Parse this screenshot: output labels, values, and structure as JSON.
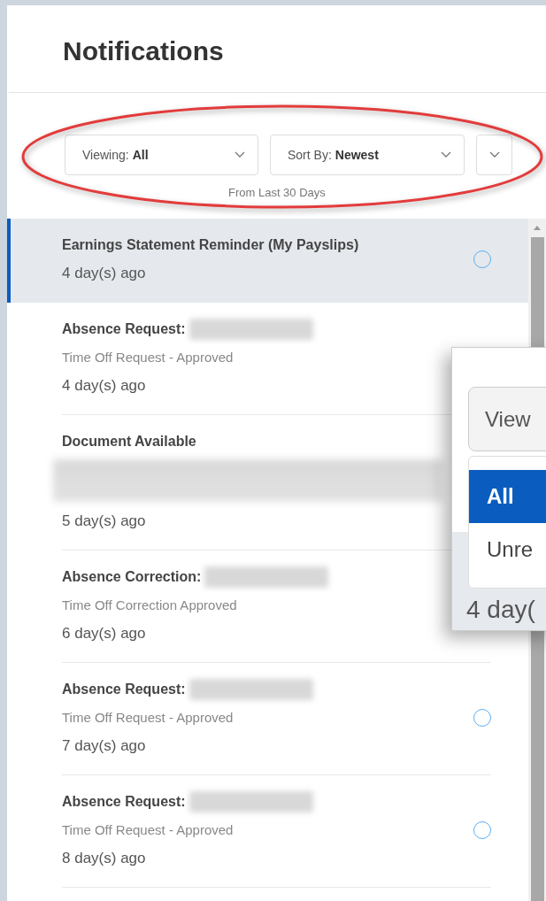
{
  "header": {
    "title": "Notifications"
  },
  "filters": {
    "viewing": {
      "label": "Viewing:",
      "value": "All"
    },
    "sort": {
      "label": "Sort By:",
      "value": "Newest"
    },
    "range": "From Last 30 Days"
  },
  "notifications": [
    {
      "kind": "plain",
      "title": "Earnings Statement Reminder (My Payslips)",
      "time": "4 day(s) ago",
      "selected": true,
      "unread": true
    },
    {
      "kind": "hidden_name",
      "title": "Absence Request:",
      "subtitle": "Time Off Request - Approved",
      "time": "4 day(s) ago",
      "selected": false
    },
    {
      "kind": "hidden_body",
      "title": "Document Available",
      "time": "5 day(s) ago",
      "selected": false
    },
    {
      "kind": "hidden_name",
      "title": "Absence Correction:",
      "subtitle": "Time Off Correction Approved",
      "time": "6 day(s) ago",
      "selected": false
    },
    {
      "kind": "hidden_name",
      "title": "Absence Request:",
      "subtitle": "Time Off Request - Approved",
      "time": "7 day(s) ago",
      "selected": false,
      "unread": true
    },
    {
      "kind": "hidden_name",
      "title": "Absence Request:",
      "subtitle": "Time Off Request - Approved",
      "time": "8 day(s) ago",
      "selected": false,
      "unread": true
    }
  ],
  "zoom_inset": {
    "dropdown_label": "View",
    "options": [
      {
        "label": "All",
        "selected": true
      },
      {
        "label": "Unre",
        "selected": false
      }
    ],
    "time": "4 day("
  }
}
